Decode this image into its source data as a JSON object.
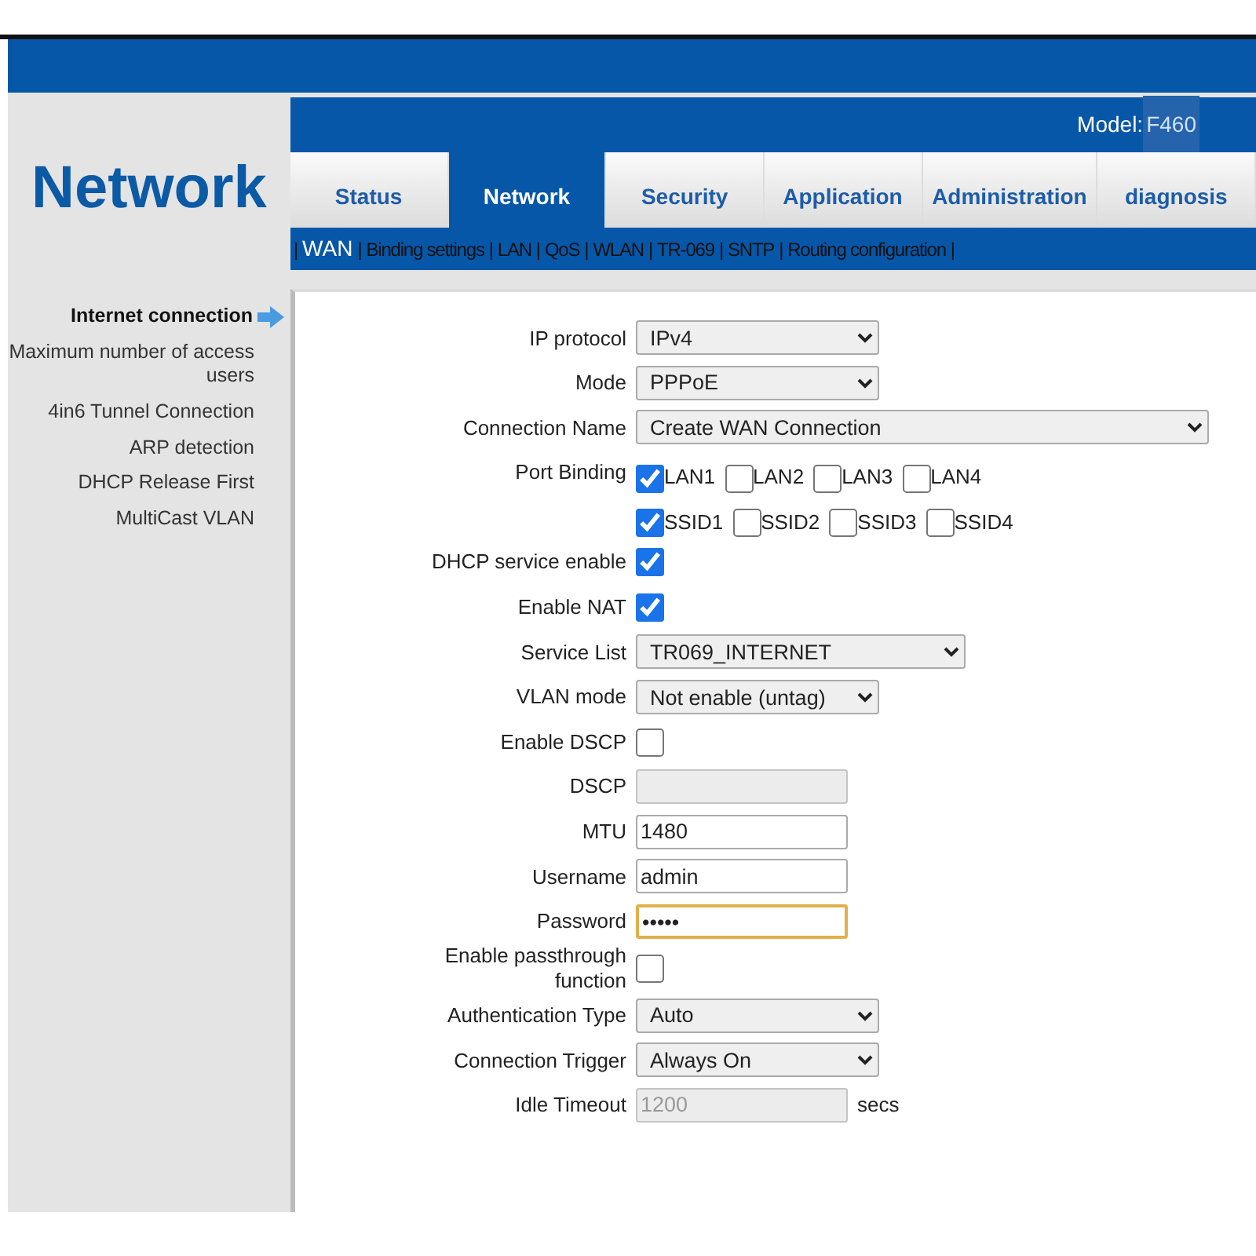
{
  "header": {
    "title": "Network",
    "model_label": "Model:",
    "model_value": "F460"
  },
  "tabs": [
    {
      "label": "Status",
      "selected": false
    },
    {
      "label": "Network",
      "selected": true
    },
    {
      "label": "Security",
      "selected": false
    },
    {
      "label": "Application",
      "selected": false
    },
    {
      "label": "Administration",
      "selected": false
    },
    {
      "label": "diagnosis",
      "selected": false
    }
  ],
  "subnav": {
    "separators": [
      "|",
      "|",
      "|",
      "|",
      "|",
      "|",
      "|",
      "|",
      "|"
    ],
    "items": [
      {
        "label": "WAN",
        "selected": true
      },
      {
        "label": "Binding settings",
        "selected": false
      },
      {
        "label": "LAN",
        "selected": false
      },
      {
        "label": "QoS",
        "selected": false
      },
      {
        "label": "WLAN",
        "selected": false
      },
      {
        "label": "TR-069",
        "selected": false
      },
      {
        "label": "SNTP",
        "selected": false
      },
      {
        "label": "Routing configuration",
        "selected": false
      }
    ]
  },
  "sidebar": {
    "items": [
      {
        "label": "Internet connection",
        "selected": true
      },
      {
        "label": "Maximum number of access users",
        "selected": false
      },
      {
        "label": "4in6 Tunnel Connection",
        "selected": false
      },
      {
        "label": "ARP detection",
        "selected": false
      },
      {
        "label": "DHCP Release First",
        "selected": false
      },
      {
        "label": "MultiCast VLAN",
        "selected": false
      }
    ]
  },
  "form": [
    {
      "kind": "select",
      "label": "IP protocol",
      "value": "IPv4"
    },
    {
      "kind": "select",
      "label": "Mode",
      "value": "PPPoE"
    },
    {
      "kind": "select",
      "label": "Connection Name",
      "value": "Create WAN Connection"
    },
    {
      "kind": "checkgroup",
      "label": "Port Binding",
      "options": [
        {
          "label": "LAN1",
          "checked": true
        },
        {
          "label": "LAN2",
          "checked": false
        },
        {
          "label": "LAN3",
          "checked": false
        },
        {
          "label": "LAN4",
          "checked": false
        }
      ]
    },
    {
      "kind": "checkgroup",
      "options": [
        {
          "label": "SSID1",
          "checked": true
        },
        {
          "label": "SSID2",
          "checked": false
        },
        {
          "label": "SSID3",
          "checked": false
        },
        {
          "label": "SSID4",
          "checked": false
        }
      ]
    },
    {
      "kind": "checkbox",
      "label": "DHCP service enable",
      "checked": true
    },
    {
      "kind": "checkbox",
      "label": "Enable NAT",
      "checked": true
    },
    {
      "kind": "select",
      "label": "Service List",
      "value": "TR069_INTERNET"
    },
    {
      "kind": "select",
      "label": "VLAN mode",
      "value": "Not enable (untag)"
    },
    {
      "kind": "checkbox",
      "label": "Enable DSCP",
      "checked": false
    },
    {
      "kind": "text",
      "label": "DSCP",
      "disabled": true
    },
    {
      "kind": "text",
      "label": "MTU",
      "value": "1480",
      "disabled": false
    },
    {
      "kind": "text",
      "label": "Username",
      "value": "admin",
      "disabled": false
    },
    {
      "kind": "password",
      "label": "Password",
      "value": "•••••",
      "focused": true
    },
    {
      "kind": "checkbox",
      "label": "Enable passthrough function",
      "checked": false
    },
    {
      "kind": "select",
      "label": "Authentication Type",
      "value": "Auto"
    },
    {
      "kind": "select",
      "label": "Connection Trigger",
      "value": "Always On"
    },
    {
      "kind": "text",
      "label": "Idle Timeout",
      "value": "1200",
      "disabled": true,
      "unit": "secs"
    }
  ]
}
